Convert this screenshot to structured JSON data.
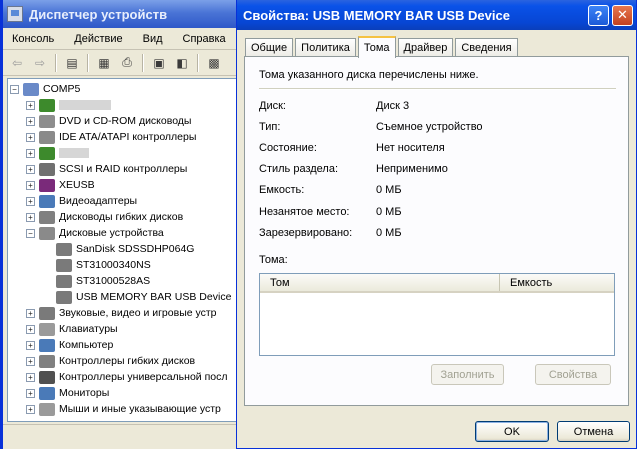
{
  "device_manager": {
    "title": "Диспетчер устройств",
    "menu": [
      "Консоль",
      "Действие",
      "Вид",
      "Справка"
    ],
    "tree": {
      "root": "COMP5",
      "items": [
        {
          "label": "",
          "icon": "gpu-board-icon",
          "color": "#3d8a2c",
          "redacted_width": 52
        },
        {
          "label": "DVD и CD-ROM дисководы",
          "icon": "cdrom-icon",
          "color": "#8d8d8d"
        },
        {
          "label": "IDE ATA/ATAPI контроллеры",
          "icon": "ide-controller-icon",
          "color": "#8a8a8a"
        },
        {
          "label": "",
          "icon": "board-icon",
          "color": "#3d8a2c",
          "redacted_width": 30
        },
        {
          "label": "SCSI и RAID контроллеры",
          "icon": "scsi-icon",
          "color": "#707070"
        },
        {
          "label": "XEUSB",
          "icon": "usb-icon",
          "color": "#7a2a7a"
        },
        {
          "label": "Видеоадаптеры",
          "icon": "display-adapter-icon",
          "color": "#4a7ab8"
        },
        {
          "label": "Дисководы гибких дисков",
          "icon": "floppy-icon",
          "color": "#808080"
        },
        {
          "label": "Дисковые устройства",
          "icon": "disk-drive-icon",
          "color": "#8a8a8a",
          "expanded": true
        },
        {
          "label": "SanDisk SDSSDHP064G",
          "icon": "disk-icon",
          "color": "#7a7a7a",
          "child": true
        },
        {
          "label": "ST31000340NS",
          "icon": "disk-icon",
          "color": "#7a7a7a",
          "child": true
        },
        {
          "label": "ST31000528AS",
          "icon": "disk-icon",
          "color": "#7a7a7a",
          "child": true
        },
        {
          "label": "USB MEMORY BAR USB Device",
          "icon": "disk-icon",
          "color": "#7a7a7a",
          "child": true
        },
        {
          "label": "Звуковые, видео и игровые устр",
          "icon": "sound-icon",
          "color": "#7a7a7a"
        },
        {
          "label": "Клавиатуры",
          "icon": "keyboard-icon",
          "color": "#9a9a9a"
        },
        {
          "label": "Компьютер",
          "icon": "computer-icon",
          "color": "#4a7ab8"
        },
        {
          "label": "Контроллеры гибких дисков",
          "icon": "floppy-controller-icon",
          "color": "#808080"
        },
        {
          "label": "Контроллеры универсальной посл",
          "icon": "usb-controller-icon",
          "color": "#505050"
        },
        {
          "label": "Мониторы",
          "icon": "monitor-icon",
          "color": "#4a7ab8"
        },
        {
          "label": "Мыши и иные указывающие устр",
          "icon": "mouse-icon",
          "color": "#9a9a9a"
        }
      ]
    }
  },
  "dialog": {
    "title": "Свойства: USB MEMORY BAR USB Device",
    "tabs": [
      "Общие",
      "Политика",
      "Тома",
      "Драйвер",
      "Сведения"
    ],
    "active_tab": "Тома",
    "intro": "Тома указанного диска перечислены ниже.",
    "properties": [
      {
        "label": "Диск:",
        "value": "Диск 3"
      },
      {
        "label": "Тип:",
        "value": "Съемное устройство"
      },
      {
        "label": "Состояние:",
        "value": "Нет носителя"
      },
      {
        "label": "Стиль раздела:",
        "value": "Неприменимо"
      },
      {
        "label": "Емкость:",
        "value": "0 МБ"
      },
      {
        "label": "Незанятое место:",
        "value": "0 МБ"
      },
      {
        "label": "Зарезервировано:",
        "value": "0 МБ"
      }
    ],
    "volumes_label": "Тома:",
    "volume_columns": [
      "Том",
      "Емкость"
    ],
    "volume_rows": [],
    "fill_button": "Заполнить",
    "properties_button": "Свойства",
    "ok_button": "OK",
    "cancel_button": "Отмена",
    "help_glyph": "?",
    "close_glyph": "✕"
  }
}
